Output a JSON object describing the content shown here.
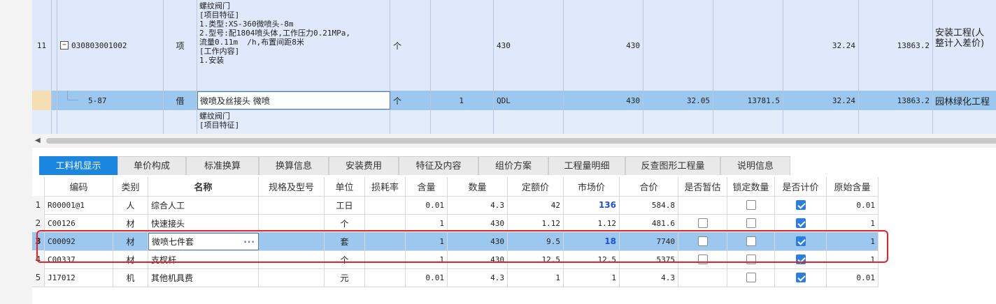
{
  "top_grid": {
    "row_11": {
      "index": "11",
      "code": "030803001002",
      "type": "项",
      "description_lines": [
        "螺纹阀门",
        "[项目特征]",
        "1.类型:XS-360微喷头-8m",
        "2.型号:配1804喷头体,工作压力0.21MPa,",
        "流量0.11m  /h,布置间距8米",
        "[工作内容]",
        "1.安装"
      ],
      "unit": "个",
      "qty_code": "430",
      "qty": "430",
      "unit_price": "32.24",
      "total": "13863.2",
      "category_line1": "安装工程(人",
      "category_line2": "整计入差价)"
    },
    "row_587": {
      "code": "5-87",
      "type": "借",
      "name": "微喷及丝接头 微喷",
      "unit": "个",
      "coef": "1",
      "qty_code": "QDL",
      "qty": "430",
      "price": "32.05",
      "amount": "13781.5",
      "unit_price": "32.24",
      "total": "13863.2",
      "category": "园林绿化工程"
    },
    "row_next": {
      "description_lines": [
        "螺纹阀门",
        "[项目特征]"
      ]
    }
  },
  "tabs": [
    "工料机显示",
    "单价构成",
    "标准换算",
    "换算信息",
    "安装费用",
    "特征及内容",
    "组价方案",
    "工程量明细",
    "反查图形工程量",
    "说明信息"
  ],
  "active_tab": "工料机显示",
  "table": {
    "headers": [
      "",
      "编码",
      "类别",
      "名称",
      "规格及型号",
      "单位",
      "损耗率",
      "含量",
      "数量",
      "定额价",
      "市场价",
      "合价",
      "是否暂估",
      "锁定数量",
      "是否计价",
      "原始含量"
    ],
    "rows": [
      {
        "n": "1",
        "code": "R00001@1",
        "cat": "人",
        "name": "综合人工",
        "spec": "",
        "unit": "工日",
        "loss": "",
        "content": "0.01",
        "qty": "4.3",
        "quota": "42",
        "market": "136",
        "total": "584.8",
        "est": "none",
        "lock": "off",
        "priced": "on",
        "orig": "0.01"
      },
      {
        "n": "2",
        "code": "C00126",
        "cat": "材",
        "name": "快速接头",
        "spec": "",
        "unit": "个",
        "loss": "",
        "content": "1",
        "qty": "430",
        "quota": "1.12",
        "market": "1.12",
        "total": "481.6",
        "est": "off",
        "lock": "off",
        "priced": "on",
        "orig": "1"
      },
      {
        "n": "3",
        "code": "C00092",
        "cat": "材",
        "name": "微喷七件套",
        "spec": "",
        "unit": "套",
        "loss": "",
        "content": "1",
        "qty": "430",
        "quota": "9.5",
        "market": "18",
        "total": "7740",
        "est": "off",
        "lock": "off",
        "priced": "on",
        "orig": "1"
      },
      {
        "n": "4",
        "code": "C00337",
        "cat": "材",
        "name": "支杈杆",
        "spec": "",
        "unit": "个",
        "loss": "",
        "content": "1",
        "qty": "430",
        "quota": "12.5",
        "market": "12.5",
        "total": "5375",
        "est": "off",
        "lock": "off",
        "priced": "on",
        "orig": "1"
      },
      {
        "n": "5",
        "code": "J17012",
        "cat": "机",
        "name": "其他机具费",
        "spec": "",
        "unit": "元",
        "loss": "",
        "content": "0.01",
        "qty": "4.3",
        "quota": "1",
        "market": "1",
        "total": "4.3",
        "est": "none",
        "lock": "off",
        "priced": "on",
        "orig": "0.01"
      }
    ],
    "selected_row": 3,
    "name_input_ellipsis": "···"
  },
  "colors": {
    "accent": "#1a86e0",
    "selection": "#9cc8f0",
    "highlight_box": "#e8202a",
    "market_blue": "#1f4fd6"
  }
}
